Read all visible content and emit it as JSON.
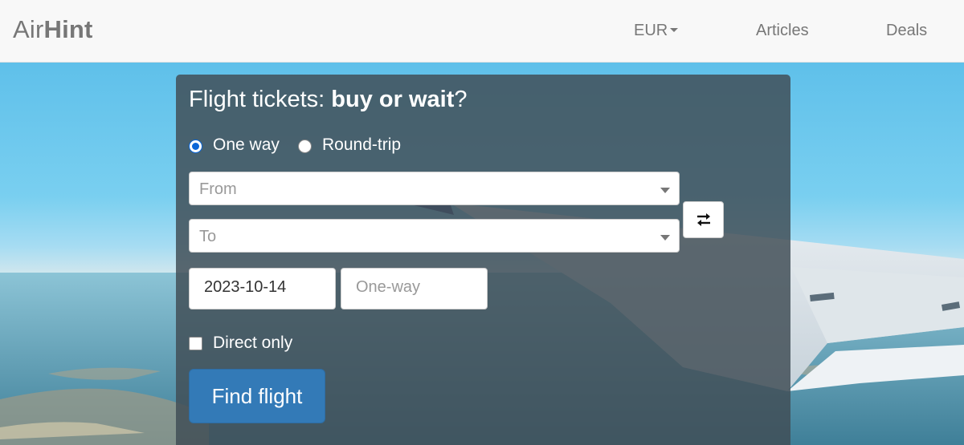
{
  "navbar": {
    "brand_light": "Air",
    "brand_bold": "Hint",
    "currency": "EUR",
    "links": [
      "Articles",
      "Deals"
    ]
  },
  "search": {
    "title_prefix": "Flight tickets: ",
    "title_bold": "buy or wait",
    "title_suffix": "?",
    "trip_type": {
      "options": [
        "One way",
        "Round-trip"
      ],
      "selected": "One way"
    },
    "from_placeholder": "From",
    "to_placeholder": "To",
    "depart_date": "2023-10-14",
    "return_placeholder": "One-way",
    "direct_only_label": "Direct only",
    "direct_only_checked": false,
    "submit_label": "Find flight"
  },
  "icons": {
    "swap": "swap-arrows-icon",
    "dropdown": "chevron-down-icon"
  },
  "colors": {
    "primary_button": "#337ab7",
    "radio_accent": "#0a66d8",
    "navbar_bg": "#f8f8f8",
    "panel_overlay": "#404e56"
  }
}
